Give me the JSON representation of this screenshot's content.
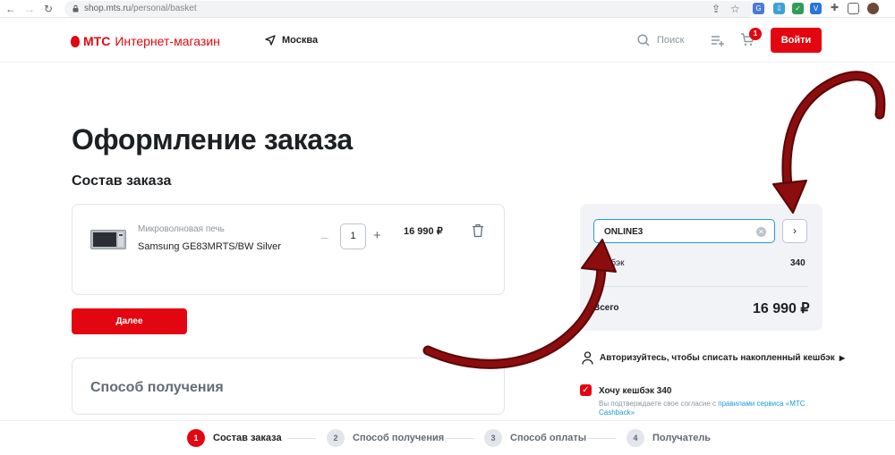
{
  "browser": {
    "url_host": "shop.mts.ru",
    "url_path": "/personal/basket"
  },
  "header": {
    "logo_mts": "МТС",
    "logo_text": "Интернет-магазин",
    "city": "Москва",
    "search_label": "Поиск",
    "cart_count": "1",
    "login_label": "Войти"
  },
  "page": {
    "title": "Оформление заказа",
    "order_heading": "Состав заказа"
  },
  "order_item": {
    "category": "Микроволновая печь",
    "name": "Samsung GE83MRTS/BW Silver",
    "minus": "–",
    "quantity": "1",
    "plus": "+",
    "price": "16 990 ₽"
  },
  "next_button": "Далее",
  "delivery": {
    "title": "Способ получения"
  },
  "summary": {
    "promo_value": "ONLINE3",
    "cashback_label": "Кешбэк",
    "cashback_value": "340",
    "total_label": "Всего",
    "total_value": "16 990 ₽"
  },
  "auth": {
    "label": "Авторизуйтесь, чтобы списать накопленный кешбэк"
  },
  "cashback_opt": {
    "label": "Хочу кешбэк 340",
    "consent_prefix": "Вы подтверждаете свое согласие с ",
    "consent_link": "правилами сервиса «МТС Cashback»"
  },
  "steps": [
    {
      "num": "1",
      "label": "Состав заказа",
      "active": true
    },
    {
      "num": "2",
      "label": "Способ получения",
      "active": false
    },
    {
      "num": "3",
      "label": "Способ оплаты",
      "active": false
    },
    {
      "num": "4",
      "label": "Получатель",
      "active": false
    }
  ],
  "colors": {
    "brand_red": "#e30611",
    "annotation_arrow": "#8b0d0d",
    "link_blue": "#1d9bd7"
  }
}
